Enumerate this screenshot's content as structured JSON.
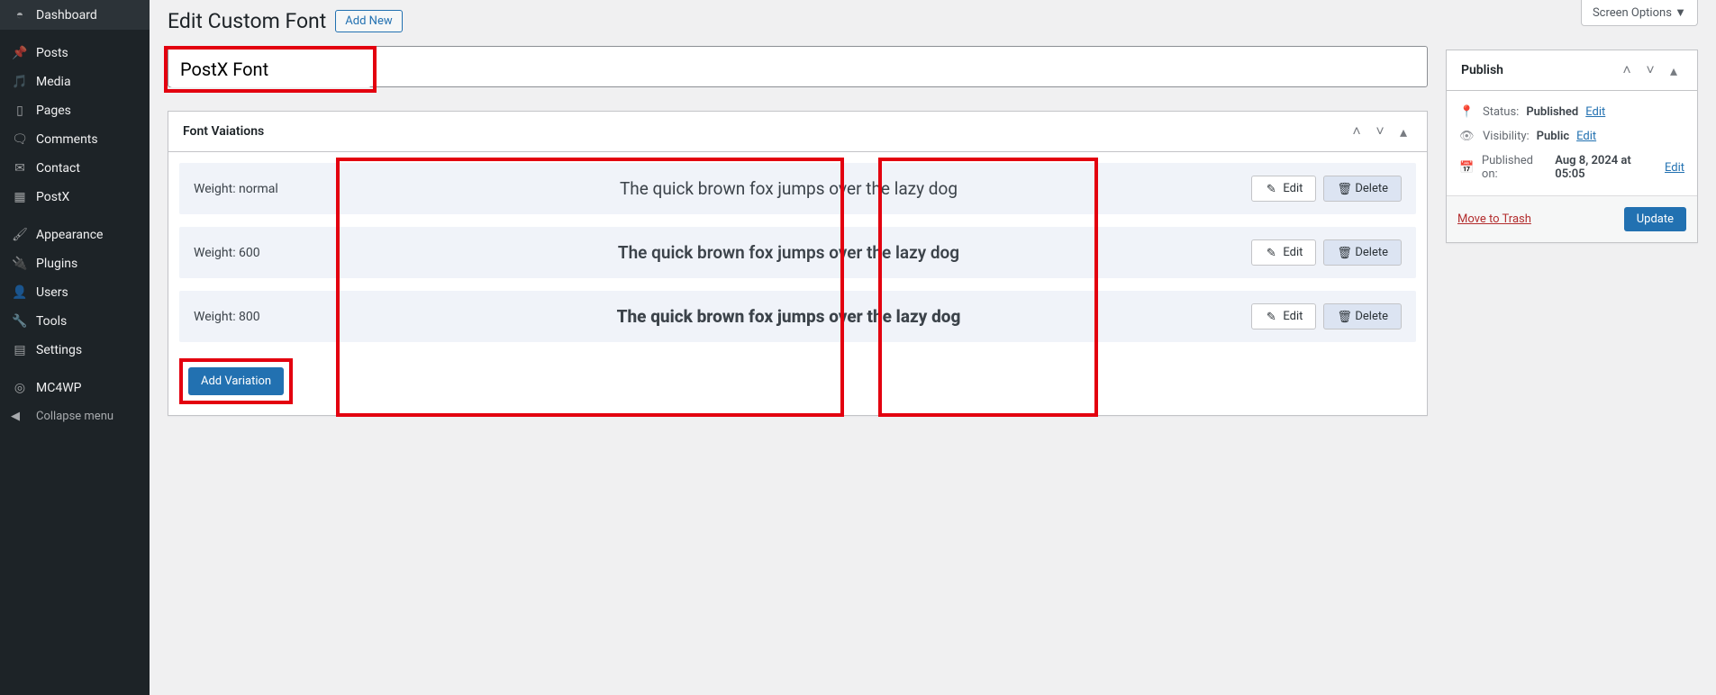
{
  "screenOptions": "Screen Options ▼",
  "sidebar": {
    "items": [
      {
        "icon": "dashboard",
        "label": "Dashboard"
      },
      {
        "icon": "pin",
        "label": "Posts"
      },
      {
        "icon": "media",
        "label": "Media"
      },
      {
        "icon": "pages",
        "label": "Pages"
      },
      {
        "icon": "comment",
        "label": "Comments"
      },
      {
        "icon": "mail",
        "label": "Contact"
      },
      {
        "icon": "postx",
        "label": "PostX"
      },
      {
        "icon": "appearance",
        "label": "Appearance"
      },
      {
        "icon": "plugins",
        "label": "Plugins"
      },
      {
        "icon": "users",
        "label": "Users"
      },
      {
        "icon": "tools",
        "label": "Tools"
      },
      {
        "icon": "settings",
        "label": "Settings"
      },
      {
        "icon": "mc4wp",
        "label": "MC4WP"
      }
    ],
    "collapse": "Collapse menu"
  },
  "header": {
    "title": "Edit Custom Font",
    "addNew": "Add New"
  },
  "titleInput": "PostX Font",
  "variations": {
    "panelTitle": "Font Vaiations",
    "rows": [
      {
        "weightLabel": "Weight: normal",
        "preview": "The quick brown fox jumps over the lazy dog",
        "fwClass": "fw-normal"
      },
      {
        "weightLabel": "Weight: 600",
        "preview": "The quick brown fox jumps over the lazy dog",
        "fwClass": "fw-600"
      },
      {
        "weightLabel": "Weight: 800",
        "preview": "The quick brown fox jumps over the lazy dog",
        "fwClass": "fw-800"
      }
    ],
    "editLabel": "Edit",
    "deleteLabel": "Delete",
    "addVariation": "Add Variation"
  },
  "publish": {
    "panelTitle": "Publish",
    "status": {
      "label": "Status:",
      "value": "Published",
      "edit": "Edit"
    },
    "visibility": {
      "label": "Visibility:",
      "value": "Public",
      "edit": "Edit"
    },
    "published": {
      "label": "Published on:",
      "value": "Aug 8, 2024 at 05:05",
      "edit": "Edit"
    },
    "trash": "Move to Trash",
    "update": "Update"
  }
}
